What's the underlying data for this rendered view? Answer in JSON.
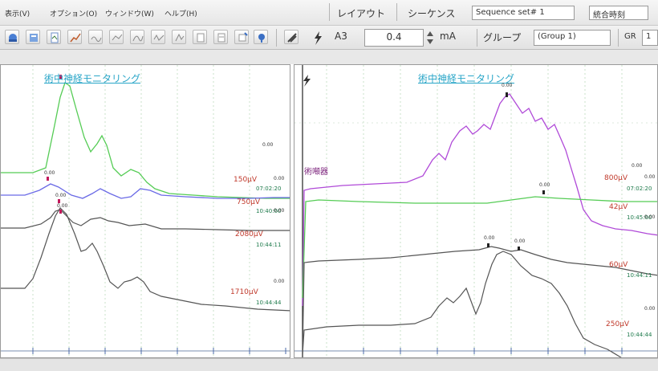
{
  "menu": {
    "items": [
      {
        "label": "表示(V)"
      },
      {
        "label": "オプション(O)"
      },
      {
        "label": "ウィンドウ(W)"
      },
      {
        "label": "ヘルプ(H)"
      }
    ],
    "layout_label": "レイアウト",
    "sequence_label": "シーケンス",
    "sequence_value": "Sequence set# 1",
    "mode_value": "統合時刻"
  },
  "toolbar": {
    "channel": "A3",
    "current_value": "0.4",
    "unit": "mA",
    "group_label": "グループ",
    "group_value": "(Group 1)",
    "gr_label": "GR",
    "gr_value": "1"
  },
  "panels": {
    "left": {
      "title": "術中神経モニタリング",
      "traces": [
        {
          "scale": "150μV",
          "time": "07:02:20",
          "marker": "0.00"
        },
        {
          "scale": "750μV",
          "time": "10:40:00",
          "marker": "0.00"
        },
        {
          "scale": "2080μV",
          "time": "10:44:11",
          "marker": "0.00"
        },
        {
          "scale": "1710μV",
          "time": "10:44:44",
          "marker": "0.00"
        }
      ],
      "marker_labels": [
        "0.00",
        "0.00",
        "0.00"
      ]
    },
    "right": {
      "title": "術中神経モニタリング",
      "annotation": "術噸器",
      "traces": [
        {
          "scale": "800μV",
          "time": "07:02:20",
          "marker": "0.00"
        },
        {
          "scale": "42μV",
          "time": "10:45:00",
          "marker": "0.00"
        },
        {
          "scale": "60μV",
          "time": "10:44:11",
          "marker": "0.00"
        },
        {
          "scale": "250μV",
          "time": "10:44:44",
          "marker": "0.00"
        }
      ],
      "marker_labels": [
        "0.00",
        "0.00",
        "0.00",
        "0.00"
      ]
    }
  },
  "colors": {
    "green": "#55cc55",
    "blue": "#6a6ae6",
    "gray": "#555555",
    "magenta": "#b04ad8",
    "grid": "#c9e2c9",
    "title": "#2aa6c8"
  }
}
